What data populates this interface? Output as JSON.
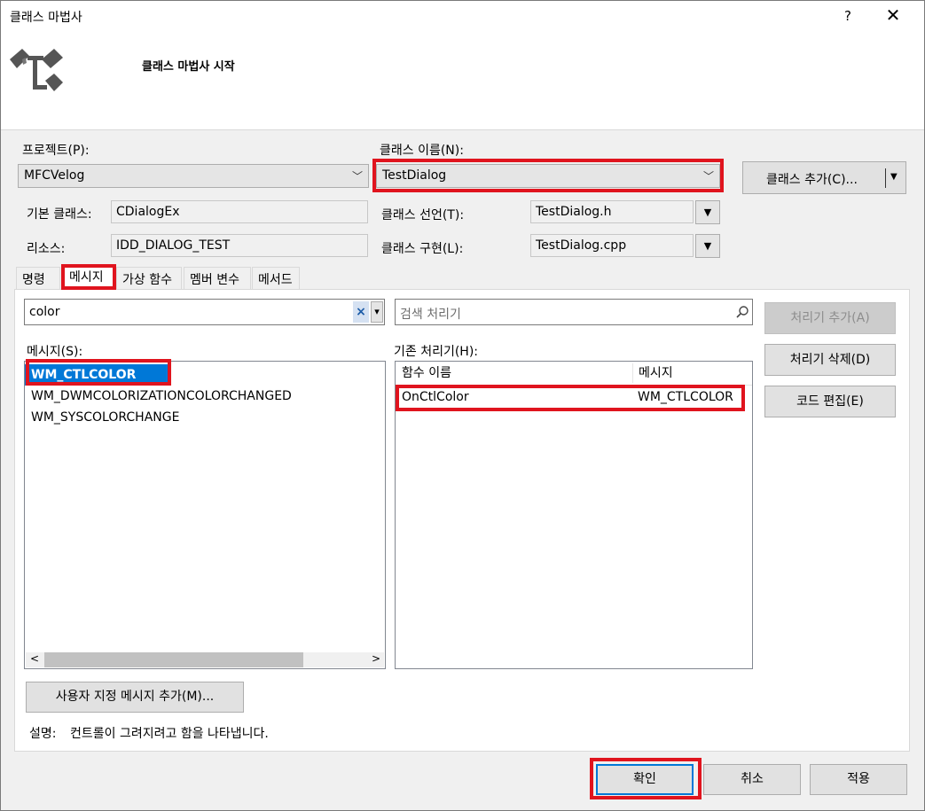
{
  "window": {
    "title": "클래스 마법사",
    "help": "?",
    "close": "✕"
  },
  "header": {
    "title": "클래스 마법사 시작"
  },
  "project": {
    "label": "프로젝트(P):",
    "value": "MFCVelog"
  },
  "class_name": {
    "label": "클래스 이름(N):",
    "value": "TestDialog"
  },
  "add_class_button": {
    "label": "클래스 추가(C)...",
    "arrow": "▼"
  },
  "base_class": {
    "label": "기본 클래스:",
    "value": "CDialogEx"
  },
  "resource": {
    "label": "리소스:",
    "value": "IDD_DIALOG_TEST"
  },
  "class_decl": {
    "label": "클래스 선언(T):",
    "value": "TestDialog.h"
  },
  "class_impl": {
    "label": "클래스 구현(L):",
    "value": "TestDialog.cpp"
  },
  "tabs": [
    {
      "label": "명령"
    },
    {
      "label": "메시지"
    },
    {
      "label": "가상 함수"
    },
    {
      "label": "멤버 변수"
    },
    {
      "label": "메서드"
    }
  ],
  "message_filter": {
    "value": "color",
    "clear": "×",
    "dropdown": "▾"
  },
  "handler_search": {
    "placeholder": "검색 처리기"
  },
  "messages_label": "메시지(S):",
  "messages": [
    {
      "name": "WM_CTLCOLOR",
      "selected": true
    },
    {
      "name": "WM_DWMCOLORIZATIONCOLORCHANGED",
      "selected": false
    },
    {
      "name": "WM_SYSCOLORCHANGE",
      "selected": false
    }
  ],
  "existing_handlers_label": "기존 처리기(H):",
  "handler_columns": {
    "function": "함수 이름",
    "message": "메시지"
  },
  "handlers": [
    {
      "function": "OnCtlColor",
      "message": "WM_CTLCOLOR"
    }
  ],
  "side_buttons": {
    "add_handler": "처리기 추가(A)",
    "delete_handler": "처리기 삭제(D)",
    "edit_code": "코드 편집(E)"
  },
  "add_custom_message": "사용자 지정 메시지 추가(M)...",
  "description": {
    "label": "설명:",
    "text": "컨트롤이 그려지려고 함을 나타냅니다."
  },
  "footer": {
    "ok": "확인",
    "cancel": "취소",
    "apply": "적용"
  },
  "scroll": {
    "left": "<",
    "right": ">"
  },
  "colors": {
    "accent_selection": "#0078d7",
    "highlight_outline": "#e0141e"
  }
}
